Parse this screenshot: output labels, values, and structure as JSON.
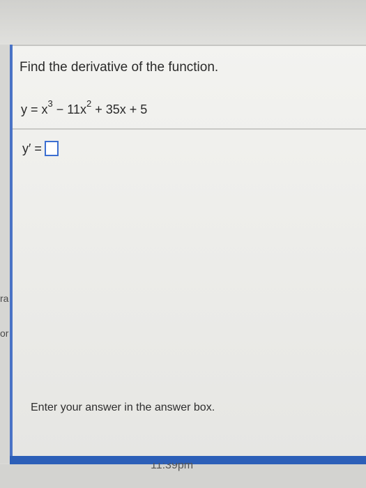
{
  "question": {
    "prompt": "Find the derivative of the function.",
    "equation": {
      "lhs": "y = x",
      "exp1": "3",
      "mid": " − 11x",
      "exp2": "2",
      "rest": " + 35x + 5"
    },
    "answer_label": "y′ =",
    "answer_value": "",
    "instruction": "Enter your answer in the answer box."
  },
  "background": {
    "left_fragments": [
      "ra",
      "or"
    ],
    "time_fragment": "11:39pm"
  },
  "colors": {
    "accent": "#2c5fb8",
    "answer_box_border": "#3c6fd1"
  }
}
